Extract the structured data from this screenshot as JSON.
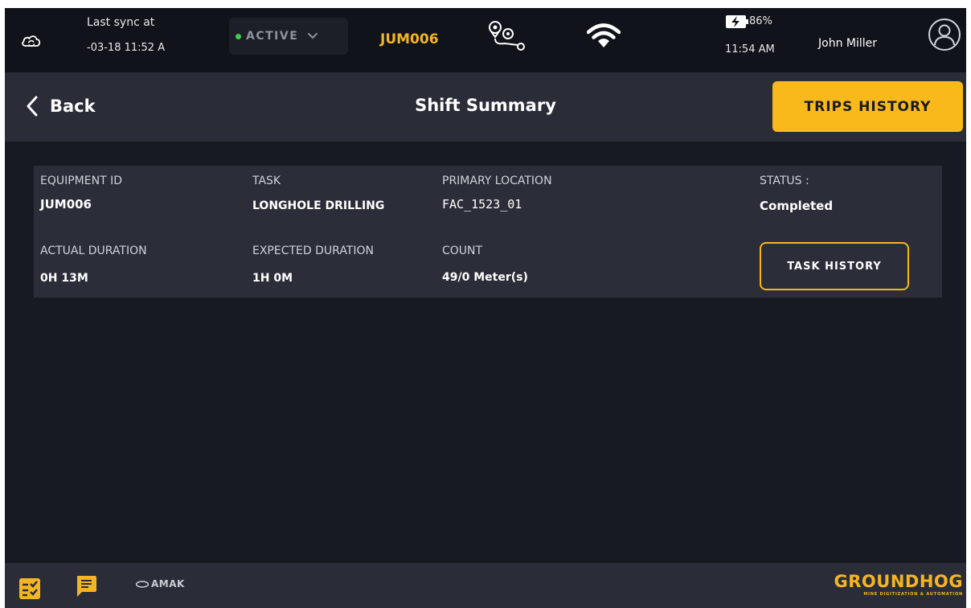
{
  "status_bar": {
    "sync_label": "Last sync at",
    "sync_time": "-03-18 11:52 A",
    "shift_status": "ACTIVE",
    "equipment_id": "JUM006",
    "battery_percent": "86%",
    "time": "11:54 AM",
    "user_name": "John Miller"
  },
  "header": {
    "back_label": "Back",
    "title": "Shift Summary",
    "trips_history_label": "TRIPS HISTORY"
  },
  "summary": {
    "equipment_id_label": "EQUIPMENT ID",
    "equipment_id_value": "JUM006",
    "task_label": "TASK",
    "task_value": "LONGHOLE DRILLING",
    "primary_location_label": "PRIMARY LOCATION",
    "primary_location_value": "FAC_1523_01",
    "status_label": "STATUS :",
    "status_value": "Completed",
    "actual_duration_label": "ACTUAL DURATION",
    "actual_duration_value": "0H 13M",
    "expected_duration_label": "EXPECTED DURATION",
    "expected_duration_value": "1H 0M",
    "count_label": "COUNT",
    "count_value": "49/0 Meter(s)",
    "task_history_label": "TASK HISTORY"
  },
  "bottom_bar": {
    "partner_logo": "AMAK",
    "brand_name": "GROUNDHOG",
    "brand_tagline": "MINE DIGITIZATION & AUTOMATION"
  },
  "colors": {
    "accent": "#F9B91B",
    "background": "#181A23",
    "panel": "#2A2D38",
    "active_dot": "#3ECF4C"
  },
  "icons": {
    "cloud": "cloud-sync-icon",
    "dropdown": "chevron-down-icon",
    "route": "route-pins-icon",
    "wifi": "wifi-icon",
    "battery": "battery-charging-icon",
    "avatar": "user-avatar-icon",
    "back": "chevron-left-icon",
    "checklist": "checklist-icon",
    "chat": "chat-icon"
  }
}
